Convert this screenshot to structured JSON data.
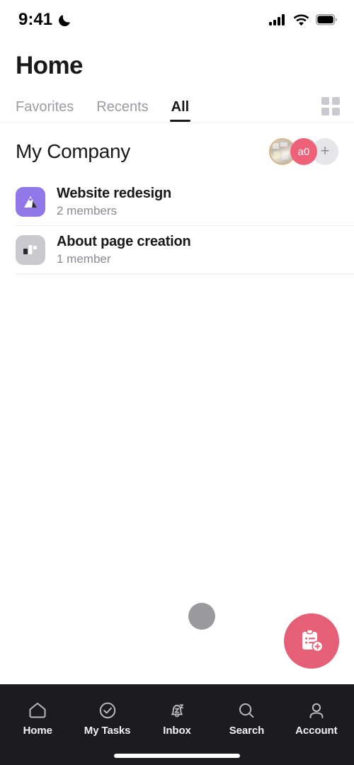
{
  "status_bar": {
    "time": "9:41",
    "dnd_icon": "moon-icon",
    "signal_icon": "cellular-signal-icon",
    "wifi_icon": "wifi-icon",
    "battery_icon": "battery-full-icon"
  },
  "header": {
    "title": "Home",
    "tabs": [
      {
        "label": "Favorites",
        "active": false
      },
      {
        "label": "Recents",
        "active": false
      },
      {
        "label": "All",
        "active": true
      }
    ],
    "grid_view_icon": "grid-view-icon"
  },
  "section": {
    "title": "My Company",
    "avatars": [
      {
        "type": "photo",
        "label": ""
      },
      {
        "type": "initials",
        "label": "a0"
      },
      {
        "type": "add",
        "label": "+"
      }
    ]
  },
  "projects": [
    {
      "name": "Website redesign",
      "members": "2 members",
      "icon": "triangle-project-icon",
      "icon_color": "#9277e8"
    },
    {
      "name": "About page creation",
      "members": "1 member",
      "icon": "board-project-icon",
      "icon_color": "#c9c9ce"
    }
  ],
  "loading": {
    "indicator": "loading-dot"
  },
  "fab": {
    "icon": "add-task-clipboard-icon",
    "color": "#e55f77"
  },
  "bottom_nav": [
    {
      "label": "Home",
      "icon": "home-icon"
    },
    {
      "label": "My Tasks",
      "icon": "check-circle-icon"
    },
    {
      "label": "Inbox",
      "icon": "bell-snooze-icon"
    },
    {
      "label": "Search",
      "icon": "search-icon"
    },
    {
      "label": "Account",
      "icon": "person-icon"
    }
  ],
  "home_indicator": "home-indicator"
}
